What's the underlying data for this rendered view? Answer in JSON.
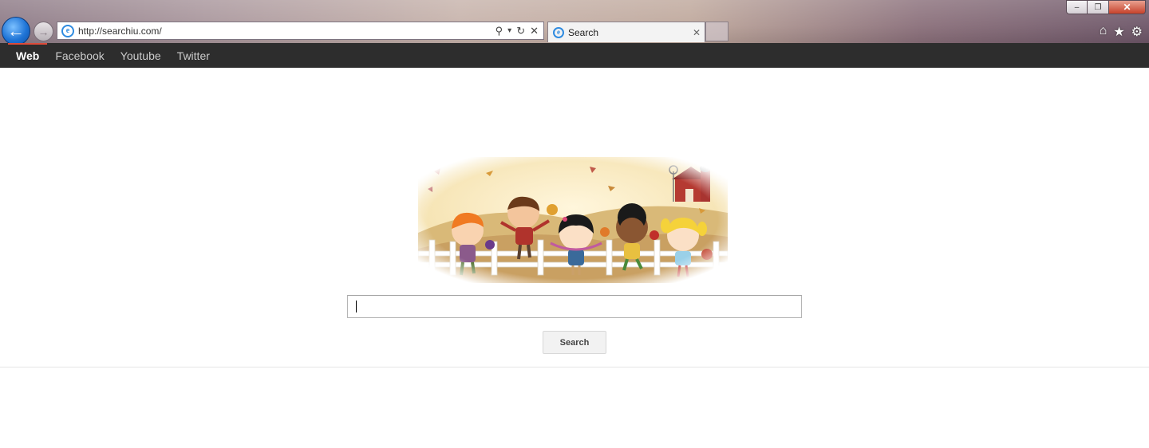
{
  "browser": {
    "back_glyph": "←",
    "forward_glyph": "→",
    "address_url": "http://searchiu.com/",
    "tab_title": "Search",
    "tab_close_glyph": "✕",
    "window_minimize_glyph": "–",
    "window_restore_glyph": "❐",
    "window_close_glyph": "✕",
    "address_search_glyph": "⚲",
    "address_dropdown_glyph": "▾",
    "address_refresh_glyph": "↻",
    "address_stop_glyph": "✕",
    "home_glyph": "⌂",
    "favorites_glyph": "★",
    "tools_glyph": "⚙",
    "ie_glyph": "e"
  },
  "topnav": {
    "items": [
      {
        "label": "Web",
        "active": true
      },
      {
        "label": "Facebook",
        "active": false
      },
      {
        "label": "Youtube",
        "active": false
      },
      {
        "label": "Twitter",
        "active": false
      }
    ]
  },
  "search": {
    "input_value": "",
    "button_label": "Search"
  },
  "colors": {
    "nav_bg": "#2d2d2d",
    "nav_active_accent": "#dd4b39",
    "page_bg": "#ffffff",
    "ie_blue": "#1f74d6"
  },
  "icons": {
    "back": "back-arrow-icon",
    "forward": "forward-arrow-icon",
    "ie": "internet-explorer-icon",
    "search": "search-icon",
    "refresh": "refresh-icon",
    "stop": "stop-icon",
    "home": "home-icon",
    "favorites": "star-icon",
    "tools": "gear-icon"
  }
}
